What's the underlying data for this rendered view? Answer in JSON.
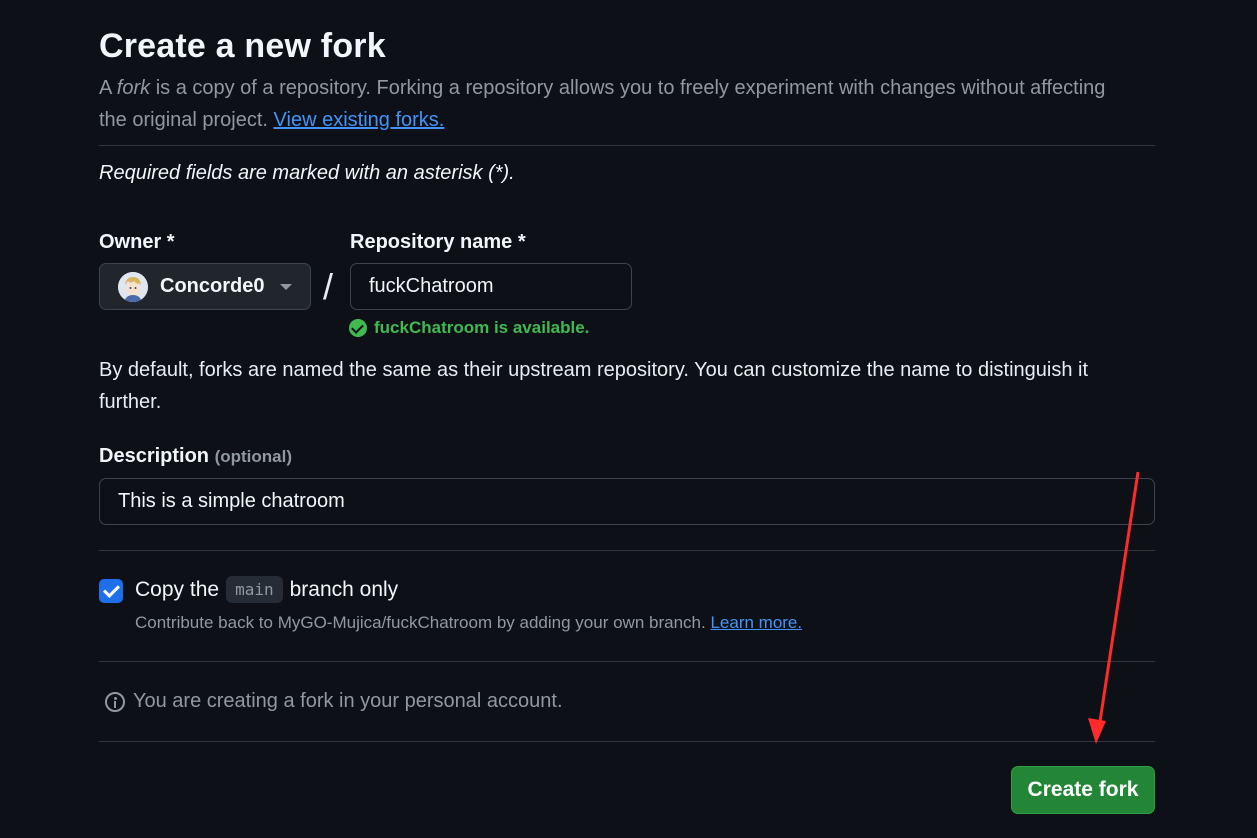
{
  "header": {
    "title": "Create a new fork",
    "intro_prefix": "A ",
    "intro_fork_word": "fork",
    "intro_rest": " is a copy of a repository. Forking a repository allows you to freely experiment with changes without affecting the original project. ",
    "view_forks_link": "View existing forks."
  },
  "form": {
    "required_note": "Required fields are marked with an asterisk (*).",
    "owner_label": "Owner *",
    "owner_value": "Concorde0",
    "slash": "/",
    "repo_label": "Repository name *",
    "repo_value": "fuckChatroom",
    "availability": "fuckChatroom is available.",
    "naming_note": "By default, forks are named the same as their upstream repository. You can customize the name to distinguish it further.",
    "description_label": "Description",
    "description_optional": "(optional)",
    "description_value": "This is a simple chatroom",
    "copy_prefix": "Copy the",
    "copy_branch": "main",
    "copy_suffix": "branch only",
    "copy_checked": true,
    "contribute_text": "Contribute back to MyGO-Mujica/fuckChatroom by adding your own branch.",
    "learn_more_link": "Learn more.",
    "info_text": "You are creating a fork in your personal account.",
    "create_button": "Create fork"
  },
  "annotation": {
    "arrow_color": "#ff2a2a"
  },
  "colors": {
    "background": "#0d1117",
    "accent_link": "#4493f8",
    "success": "#3fb950",
    "primary_button": "#238636",
    "checkbox": "#1f6feb"
  }
}
